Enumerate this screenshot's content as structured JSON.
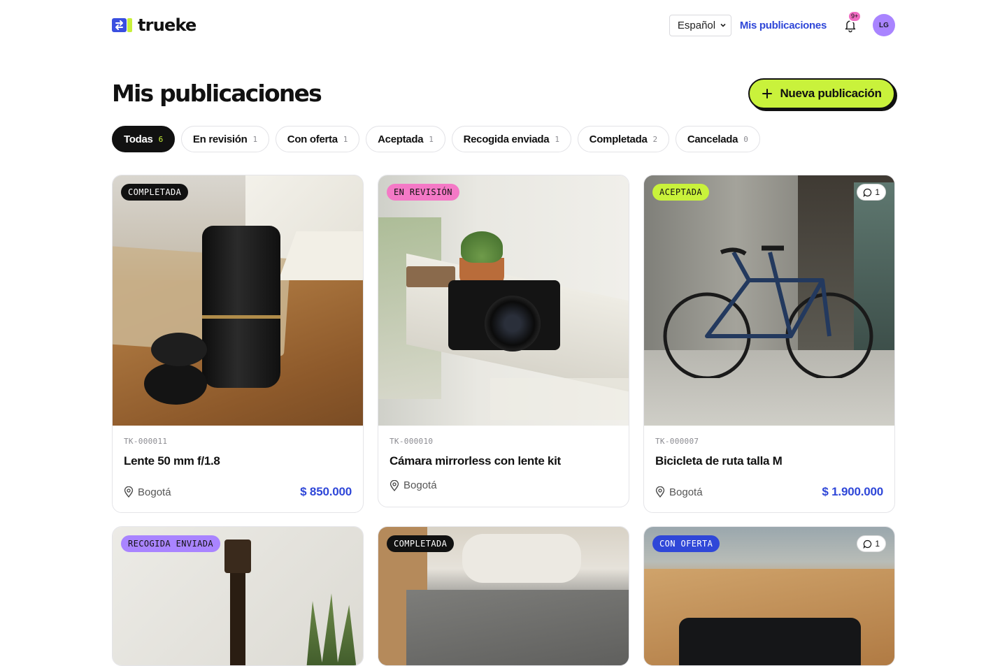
{
  "brand": {
    "name": "trueke"
  },
  "header": {
    "language": "Español",
    "my_posts_link": "Mis publicaciones",
    "notifications_badge": "9+",
    "avatar_initials": "LG"
  },
  "page": {
    "title": "Mis publicaciones",
    "new_button": "Nueva publicación"
  },
  "filters": [
    {
      "label": "Todas",
      "count": "6",
      "active": true
    },
    {
      "label": "En revisión",
      "count": "1"
    },
    {
      "label": "Con oferta",
      "count": "1"
    },
    {
      "label": "Aceptada",
      "count": "1"
    },
    {
      "label": "Recogida enviada",
      "count": "1"
    },
    {
      "label": "Completada",
      "count": "2"
    },
    {
      "label": "Cancelada",
      "count": "0"
    }
  ],
  "cards": [
    {
      "status": "COMPLETADA",
      "code": "TK-000011",
      "title": "Lente 50 mm f/1.8",
      "location": "Bogotá",
      "price": "$ 850.000"
    },
    {
      "status": "EN REVISIÓN",
      "code": "TK-000010",
      "title": "Cámara mirrorless con lente kit",
      "location": "Bogotá",
      "price": ""
    },
    {
      "status": "ACEPTADA",
      "code": "TK-000007",
      "title": "Bicicleta de ruta talla M",
      "location": "Bogotá",
      "price": "$ 1.900.000",
      "comments": "1"
    },
    {
      "status": "RECOGIDA ENVIADA"
    },
    {
      "status": "COMPLETADA"
    },
    {
      "status": "CON OFERTA",
      "comments": "1"
    }
  ],
  "colors": {
    "brand_blue": "#2f47d8",
    "lime": "#c9f23b",
    "pink": "#f479c6",
    "purple": "#a984ff"
  },
  "icons": [
    "brand-swap-icon",
    "chevron-down-icon",
    "bell-icon",
    "plus-icon",
    "comment-icon",
    "location-pin-icon"
  ]
}
